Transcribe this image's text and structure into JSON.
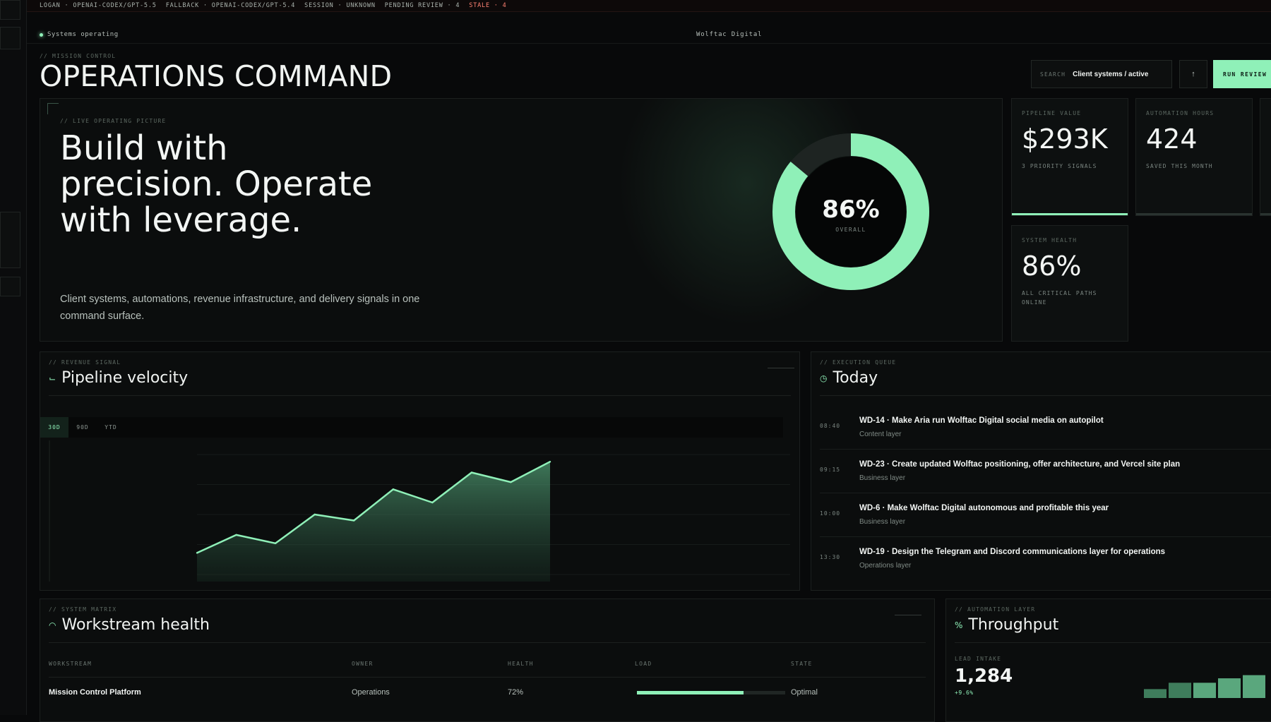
{
  "status": {
    "items": [
      "LOGAN · OPENAI-CODEX/GPT-5.5",
      "FALLBACK · OPENAI-CODEX/GPT-5.4",
      "SESSION · UNKNOWN",
      "PENDING REVIEW · 4"
    ],
    "stale": "STALE · 4"
  },
  "topline": {
    "systems": "Systems operating",
    "brand": "Wolftac Digital"
  },
  "header": {
    "eyebrow": "// MISSION CONTROL",
    "title": "OPERATIONS COMMAND",
    "search_label": "SEARCH",
    "search_value": "Client systems / active",
    "sort_icon": "↑",
    "run_label": "RUN REVIEW"
  },
  "hero": {
    "eyebrow": "// LIVE OPERATING PICTURE",
    "headline": "Build with precision. Operate with leverage.",
    "sub": "Client systems, automations, revenue infrastructure, and delivery signals in one command surface.",
    "donut_value": "86%",
    "donut_label": "OVERALL",
    "donut_fraction": 0.86
  },
  "stats": {
    "pipeline": {
      "eyebrow": "PIPELINE VALUE",
      "value": "$293K",
      "note": "3 PRIORITY SIGNALS"
    },
    "automation": {
      "eyebrow": "AUTOMATION HOURS",
      "value": "424",
      "note": "SAVED THIS MONTH"
    },
    "health": {
      "eyebrow": "SYSTEM HEALTH",
      "value": "86%",
      "note": "ALL CRITICAL PATHS ONLINE"
    }
  },
  "pipeline": {
    "eyebrow": "// REVENUE SIGNAL",
    "title": "Pipeline velocity",
    "ranges": [
      "30D",
      "90D",
      "YTD"
    ],
    "active_range": "30D"
  },
  "chart_data": {
    "type": "area",
    "title": "Pipeline velocity",
    "xlabel": "",
    "ylabel": "",
    "values": [
      18,
      33,
      26,
      50,
      45,
      71,
      60,
      85,
      77,
      94
    ],
    "ylim": [
      0,
      100
    ],
    "grid": true,
    "color": "#8ff0b8"
  },
  "queue": {
    "eyebrow": "// EXECUTION QUEUE",
    "title": "Today",
    "items": [
      {
        "time": "08:40",
        "title": "WD-14 · Make Aria run Wolftac Digital social media on autopilot",
        "layer": "Content layer"
      },
      {
        "time": "09:15",
        "title": "WD-23 · Create updated Wolftac positioning, offer architecture, and Vercel site plan",
        "layer": "Business layer"
      },
      {
        "time": "10:00",
        "title": "WD-6 · Make Wolftac Digital autonomous and profitable this year",
        "layer": "Business layer"
      },
      {
        "time": "13:30",
        "title": "WD-19 · Design the Telegram and Discord communications layer for operations",
        "layer": "Operations layer"
      }
    ]
  },
  "workstream": {
    "eyebrow": "// SYSTEM MATRIX",
    "title": "Workstream health",
    "columns": [
      "WORKSTREAM",
      "OWNER",
      "HEALTH",
      "LOAD",
      "STATE"
    ],
    "rows": [
      {
        "name": "Mission Control Platform",
        "owner": "Operations",
        "health": "72%",
        "load": 0.72,
        "state": "Optimal"
      }
    ]
  },
  "throughput": {
    "eyebrow": "// AUTOMATION LAYER",
    "title": "Throughput",
    "metric_label": "LEAD INTAKE",
    "value": "1,284",
    "delta": "+9.6%",
    "bars": [
      0.28,
      0.48,
      0.48,
      0.62,
      0.72
    ]
  },
  "colors": {
    "accent": "#8ff0b8",
    "background": "#08090a",
    "stale": "#ff8272"
  }
}
